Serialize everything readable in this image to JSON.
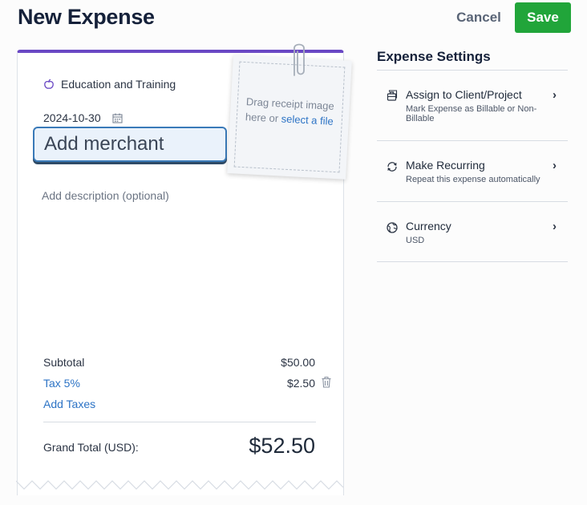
{
  "header": {
    "title": "New Expense",
    "cancel_label": "Cancel",
    "save_label": "Save"
  },
  "receipt": {
    "category": "Education and Training",
    "date": "2024-10-30",
    "merchant_placeholder": "Add merchant",
    "merchant_value": "",
    "description_placeholder": "Add description (optional)",
    "dropzone": {
      "text_line1": "Drag receipt image",
      "text_line2_prefix": "here or ",
      "link": "select a file"
    },
    "totals": {
      "subtotal_label": "Subtotal",
      "subtotal_value": "$50.00",
      "tax_label": "Tax 5%",
      "tax_value": "$2.50",
      "add_taxes_label": "Add Taxes",
      "grand_total_label": "Grand Total (USD):",
      "grand_total_value": "$52.50"
    }
  },
  "settings": {
    "title": "Expense Settings",
    "items": [
      {
        "label": "Assign to Client/Project",
        "subtitle": "Mark Expense as Billable or Non-Billable",
        "icon": "briefcase-icon"
      },
      {
        "label": "Make Recurring",
        "subtitle": "Repeat this expense automatically",
        "icon": "recurring-icon"
      },
      {
        "label": "Currency",
        "subtitle": "USD",
        "icon": "currency-icon"
      }
    ]
  },
  "colors": {
    "accent_purple": "#6a48c4",
    "save_green": "#21a53a",
    "link_blue": "#2c73c5",
    "merchant_border": "#3a7ab8"
  }
}
